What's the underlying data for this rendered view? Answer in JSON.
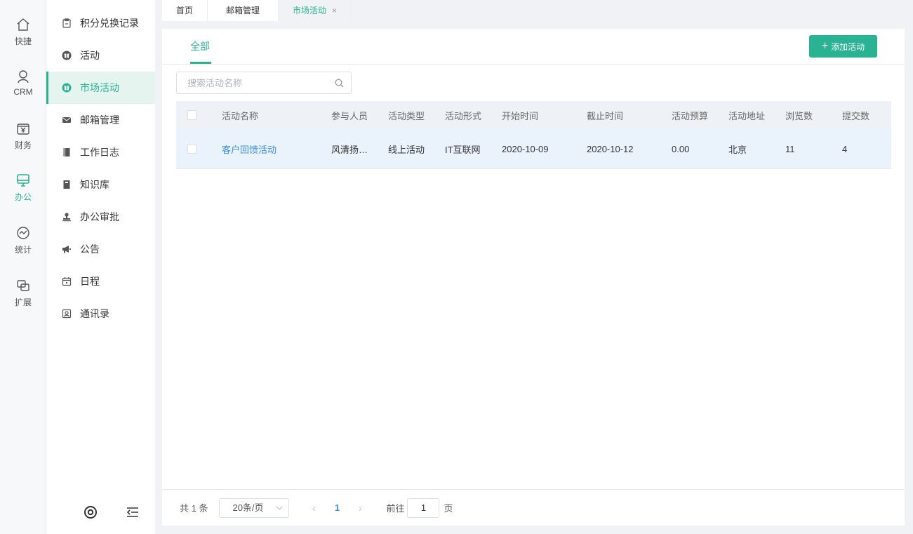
{
  "rail": {
    "items": [
      {
        "label": "快捷",
        "icon": "home-icon"
      },
      {
        "label": "CRM",
        "icon": "user-icon"
      },
      {
        "label": "财务",
        "icon": "finance-icon"
      },
      {
        "label": "办公",
        "icon": "monitor-icon",
        "active": true
      },
      {
        "label": "统计",
        "icon": "chart-icon"
      },
      {
        "label": "扩展",
        "icon": "extend-icon"
      }
    ]
  },
  "menu": {
    "items": [
      {
        "label": "积分兑换记录",
        "icon": "clipboard-icon"
      },
      {
        "label": "活动",
        "icon": "gift-icon"
      },
      {
        "label": "市场活动",
        "icon": "gift-icon",
        "active": true
      },
      {
        "label": "邮箱管理",
        "icon": "mail-icon"
      },
      {
        "label": "工作日志",
        "icon": "notebook-icon"
      },
      {
        "label": "知识库",
        "icon": "book-icon"
      },
      {
        "label": "办公审批",
        "icon": "stamp-icon"
      },
      {
        "label": "公告",
        "icon": "megaphone-icon"
      },
      {
        "label": "日程",
        "icon": "calendar-icon"
      },
      {
        "label": "通讯录",
        "icon": "contacts-icon"
      }
    ],
    "bottom_icons": [
      "settings-ring-icon",
      "collapse-menu-icon"
    ]
  },
  "tabs": [
    {
      "label": "首页"
    },
    {
      "label": "邮箱管理"
    },
    {
      "label": "市场活动",
      "active": true,
      "close": "×"
    }
  ],
  "panel": {
    "sub_tab": "全部",
    "add_button": "添加活动",
    "add_button_plus": "+",
    "search_placeholder": "搜索活动名称"
  },
  "table": {
    "columns": [
      "活动名称",
      "参与人员",
      "活动类型",
      "活动形式",
      "开始时间",
      "截止时间",
      "活动预算",
      "活动地址",
      "浏览数",
      "提交数"
    ],
    "rows": [
      {
        "name": "客户回馈活动",
        "participants": "风清扬…",
        "type": "线上活动",
        "form": "IT互联网",
        "start": "2020-10-09",
        "end": "2020-10-12",
        "budget": "0.00",
        "address": "北京",
        "views": "11",
        "submits": "4"
      }
    ]
  },
  "pager": {
    "total": "共 1 条",
    "page_size": "20条/页",
    "prev": "‹",
    "current": "1",
    "next": "›",
    "goto_label": "前往",
    "goto_value": "1",
    "page_suffix": "页"
  },
  "colors": {
    "accent": "#2ab393",
    "link": "#3a8ee6",
    "row_highlight": "#eaf2fc"
  }
}
